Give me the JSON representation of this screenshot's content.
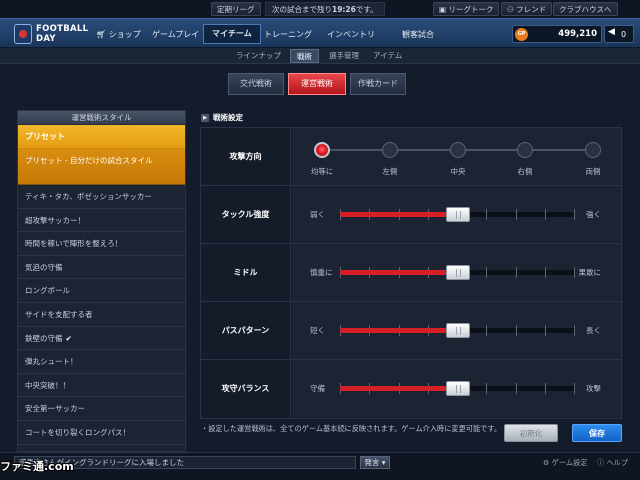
{
  "topbar": {
    "league_label": "定期リーグ",
    "next_match_prefix": "次の試合まで残り",
    "next_match_time": "19:26",
    "next_match_suffix": "です。",
    "league_talk": "リーグトーク",
    "friend": "フレンド",
    "clubhouse": "クラブハウスへ"
  },
  "brand": {
    "line1": "FOOTBALL",
    "line2": "DAY"
  },
  "nav": {
    "shop": "ショップ",
    "gameplay": "ゲームプレイ",
    "myteam": "マイチーム",
    "training": "トレーニング",
    "inventory": "インベントリ",
    "watch": "観客試合",
    "gp_label": "GP",
    "gp_value": "499,210",
    "sound_value": "0"
  },
  "subnav": [
    "ラインナップ",
    "戦術",
    "選手管理",
    "アイテム"
  ],
  "tabs": [
    "交代戦術",
    "運営戦術",
    "作戦カード"
  ],
  "left_panel": {
    "title": "運営戦術スタイル",
    "preset_head": "プリセット",
    "preset_selected": "プリセット - 自分だけの試合スタイル",
    "items": [
      "ティキ・タカ、ポゼッションサッカー",
      "超攻撃サッカー！",
      "時間を稼いで陣形を整えろ！",
      "気迫の守備",
      "ロングボール",
      "サイドを支配する者",
      "鉄壁の守備",
      "弾丸シュート！",
      "中央突破！！",
      "安全第一サッカー",
      "コートを切り裂くロングパス！"
    ],
    "checked_item": "鉄壁の守備"
  },
  "settings": {
    "section_title": "戦術設定",
    "direction": {
      "label": "攻撃方向",
      "options": [
        "均等に",
        "左側",
        "中央",
        "右側",
        "両側"
      ],
      "selected": "均等に"
    },
    "sliders": [
      {
        "label": "タックル強度",
        "left": "弱く",
        "right": "強く",
        "value": 0.5
      },
      {
        "label": "ミドル",
        "left": "慎重に",
        "right": "果敢に",
        "value": 0.5
      },
      {
        "label": "パスパターン",
        "left": "短く",
        "right": "長く",
        "value": 0.5
      },
      {
        "label": "攻守バランス",
        "left": "守備",
        "right": "攻撃",
        "value": 0.5
      }
    ]
  },
  "note": "・設定した運営戦術は、全てのゲーム基本続に反映されます。ゲーム介入時に変更可能です。",
  "buttons": {
    "reset": "初期化",
    "save": "保存"
  },
  "footer": {
    "chat_text": "遊馬恵さんがイングランドリーグに入場しました",
    "send": "発言",
    "game_settings": "ゲーム設定",
    "help": "ヘルプ"
  },
  "watermark": "ファミ通.com",
  "colors": {
    "accent_red": "#d61f26",
    "preset_orange": "#e49d14",
    "save_blue": "#1f74dd"
  }
}
